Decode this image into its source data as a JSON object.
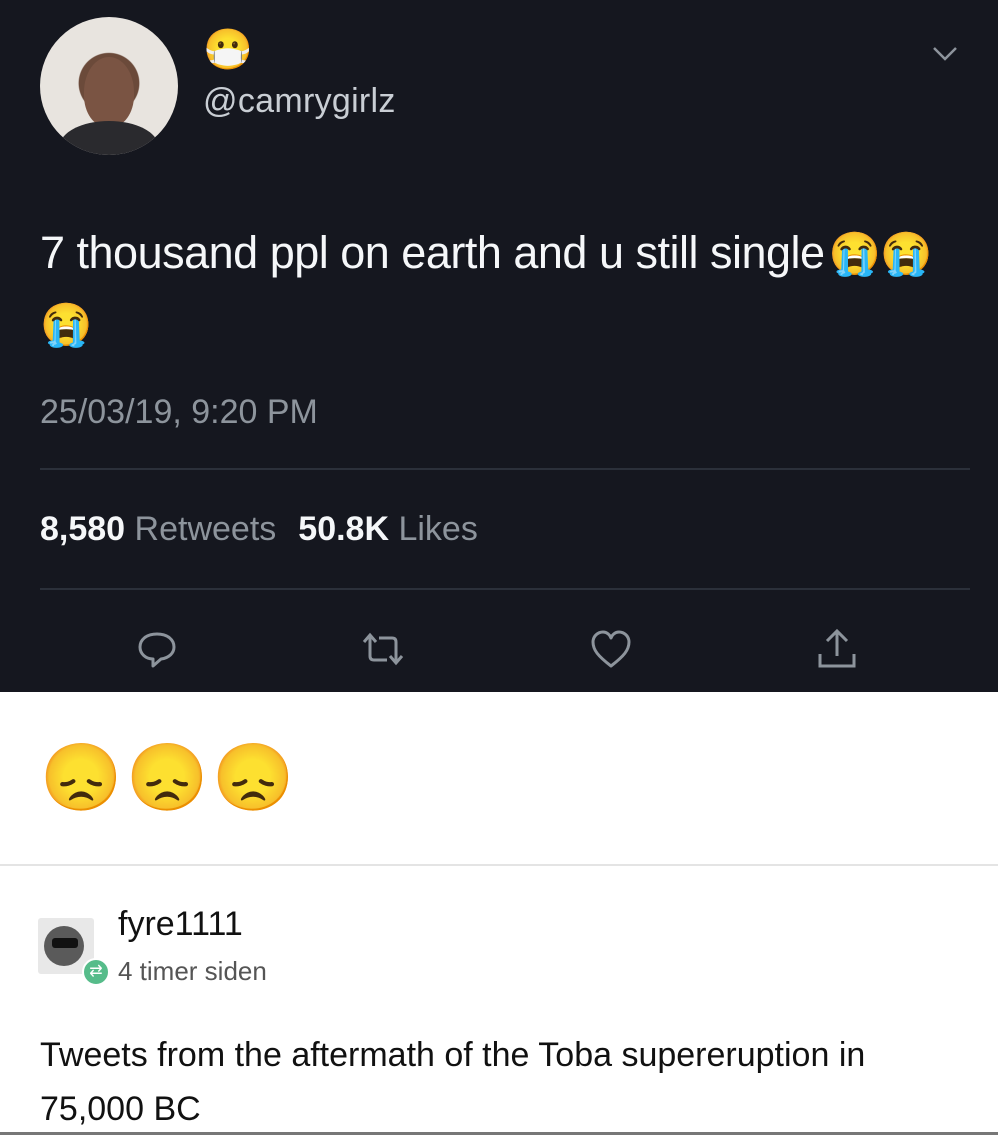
{
  "tweet": {
    "avatar_icon": "profile-photo",
    "name_emoji": "😷",
    "handle": "@camrygirlz",
    "text": "7 thousand ppl on earth and u still single",
    "text_emojis": "😭😭😭",
    "timestamp": "25/03/19, 9:20 PM",
    "retweets_count": "8,580",
    "retweets_label": "Retweets",
    "likes_count": "50.8K",
    "likes_label": "Likes",
    "actions": [
      "reply-icon",
      "retweet-icon",
      "like-icon",
      "share-icon"
    ]
  },
  "reaction": {
    "emojis": "😞😞😞"
  },
  "tumblr_post": {
    "username": "fyre1111",
    "time": "4 timer siden",
    "text": "Tweets from the aftermath of the Toba supereruption in 75,000 BC"
  },
  "colors": {
    "tweet_background": "#15171f",
    "tweet_text": "#f5f7f9",
    "muted_text": "#8d949c",
    "reblog_green": "#56bc8a"
  }
}
